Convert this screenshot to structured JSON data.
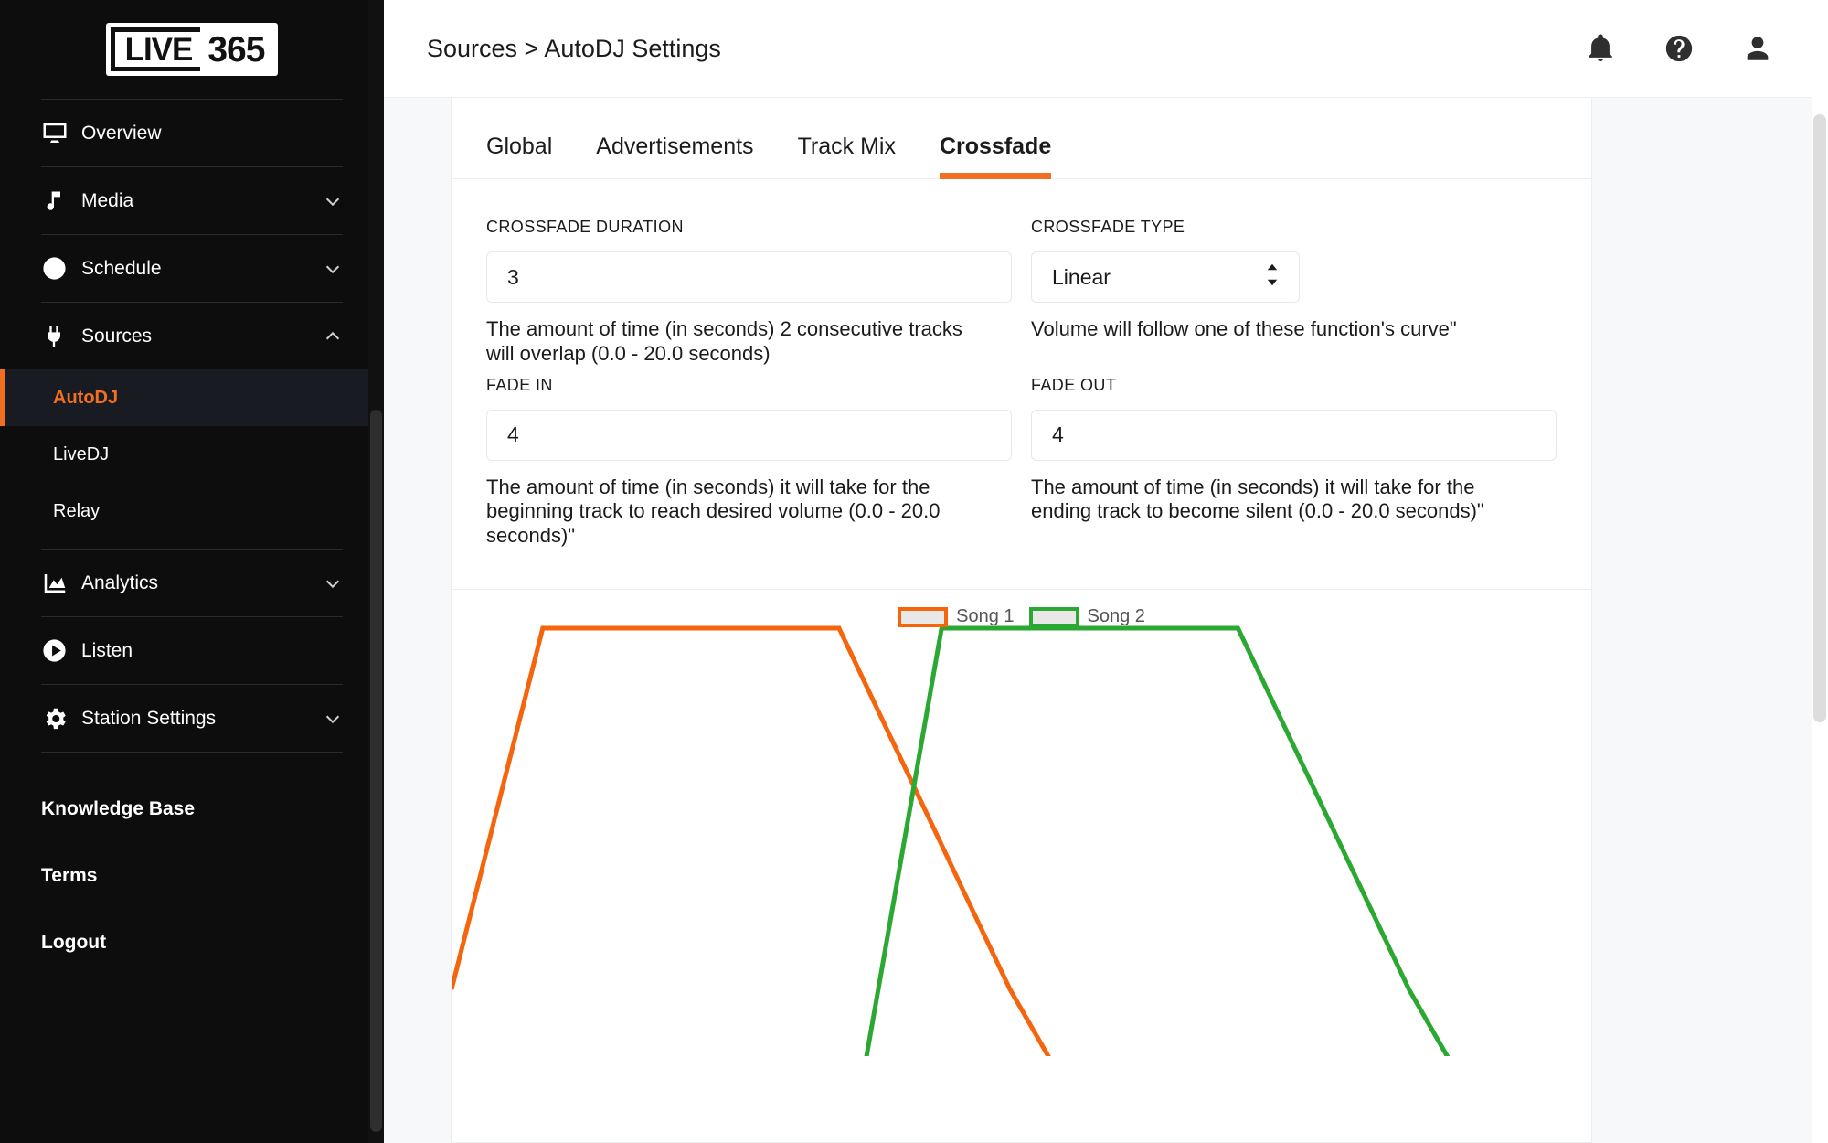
{
  "brand": {
    "logo_live": "LIVE",
    "logo_365": "365",
    "accent_color": "#f26f21"
  },
  "sidebar": {
    "groups": [
      {
        "items": [
          {
            "label": "Overview",
            "icon": "monitor-icon",
            "expandable": false
          }
        ]
      },
      {
        "items": [
          {
            "label": "Media",
            "icon": "music-note-icon",
            "expandable": true,
            "chevron": "chevron-down-icon"
          }
        ]
      },
      {
        "items": [
          {
            "label": "Schedule",
            "icon": "clock-icon",
            "expandable": true,
            "chevron": "chevron-down-icon"
          }
        ]
      },
      {
        "items": [
          {
            "label": "Sources",
            "icon": "plug-icon",
            "expandable": true,
            "chevron": "chevron-up-icon"
          }
        ],
        "subitems": [
          {
            "label": "AutoDJ",
            "active": true
          },
          {
            "label": "LiveDJ",
            "active": false
          },
          {
            "label": "Relay",
            "active": false
          }
        ]
      },
      {
        "items": [
          {
            "label": "Analytics",
            "icon": "chart-icon",
            "expandable": true,
            "chevron": "chevron-down-icon"
          }
        ]
      },
      {
        "items": [
          {
            "label": "Listen",
            "icon": "play-circle-icon",
            "expandable": false
          }
        ]
      },
      {
        "items": [
          {
            "label": "Station Settings",
            "icon": "gear-icon",
            "expandable": true,
            "chevron": "chevron-down-icon"
          }
        ]
      }
    ],
    "footer_links": [
      {
        "label": "Knowledge Base"
      },
      {
        "label": "Terms"
      },
      {
        "label": "Logout"
      }
    ]
  },
  "topbar": {
    "breadcrumb": "Sources > AutoDJ Settings",
    "icons": [
      {
        "name": "bell-icon"
      },
      {
        "name": "help-circle-icon"
      },
      {
        "name": "user-icon"
      }
    ]
  },
  "tabs": [
    {
      "label": "Global",
      "active": false
    },
    {
      "label": "Advertisements",
      "active": false
    },
    {
      "label": "Track Mix",
      "active": false
    },
    {
      "label": "Crossfade",
      "active": true
    }
  ],
  "form": {
    "crossfade_duration": {
      "label": "CROSSFADE DURATION",
      "value": "3",
      "help": "The amount of time (in seconds) 2 consecutive tracks will overlap (0.0 - 20.0 seconds)"
    },
    "crossfade_type": {
      "label": "CROSSFADE TYPE",
      "value": "Linear",
      "options": [
        "Linear"
      ],
      "help": "Volume will follow one of these function's curve\""
    },
    "fade_in": {
      "label": "FADE IN",
      "value": "4",
      "help": "The amount of time (in seconds) it will take for the beginning track to reach desired volume (0.0 - 20.0 seconds)\""
    },
    "fade_out": {
      "label": "FADE OUT",
      "value": "4",
      "help": "The amount of time (in seconds) it will take for the ending track to become silent (0.0 - 20.0 seconds)\""
    }
  },
  "chart_data": {
    "type": "line",
    "title": "",
    "xlabel": "",
    "ylabel": "",
    "grid": false,
    "legend_position": "top-center",
    "xlim": [
      0,
      100
    ],
    "ylim": [
      0,
      100
    ],
    "colors": {
      "song1": "#f4650d",
      "song2": "#2aa832"
    },
    "series": [
      {
        "name": "Song 1",
        "color": "#f4650d",
        "x": [
          0,
          8,
          34,
          49,
          57
        ],
        "y": [
          0,
          100,
          100,
          0,
          -44
        ]
      },
      {
        "name": "Song 2",
        "color": "#2aa832",
        "x": [
          35,
          43,
          69,
          84,
          92
        ],
        "y": [
          -44,
          100,
          100,
          0,
          -44
        ]
      }
    ],
    "legend": [
      {
        "label": "Song 1",
        "color": "#f4650d"
      },
      {
        "label": "Song 2",
        "color": "#2aa832"
      }
    ]
  },
  "scrollbars": {
    "sidebar": {
      "name": "sidebar-scrollbar"
    },
    "page": {
      "name": "page-scrollbar"
    }
  }
}
